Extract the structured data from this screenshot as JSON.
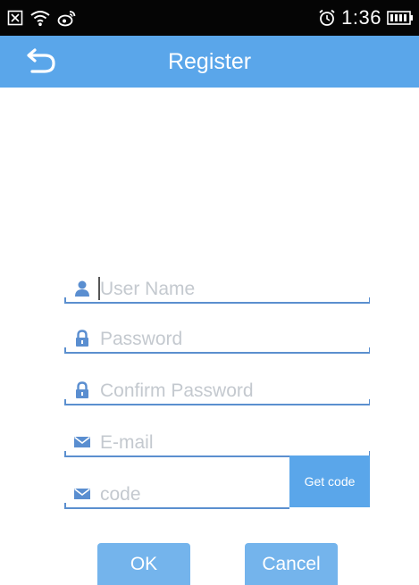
{
  "status_bar": {
    "time": "1:36",
    "icons": [
      "close-box-icon",
      "wifi-icon",
      "weibo-icon",
      "alarm-icon",
      "battery-icon"
    ]
  },
  "app_bar": {
    "title": "Register",
    "back_icon": "back-arrow-icon"
  },
  "form": {
    "username": {
      "placeholder": "User Name",
      "icon": "user-icon"
    },
    "password": {
      "placeholder": "Password",
      "icon": "lock-icon"
    },
    "confirm_password": {
      "placeholder": "Confirm Password",
      "icon": "lock-icon"
    },
    "email": {
      "placeholder": "E-mail",
      "icon": "envelope-icon"
    },
    "code": {
      "placeholder": "code",
      "icon": "envelope-icon"
    },
    "get_code_label": "Get code"
  },
  "buttons": {
    "ok_label": "OK",
    "cancel_label": "Cancel"
  },
  "colors": {
    "accent": "#5aa6ea",
    "button": "#74b4ec",
    "underline": "#5b8fcf",
    "placeholder": "#c4c9cf",
    "status_bar": "#050505"
  }
}
